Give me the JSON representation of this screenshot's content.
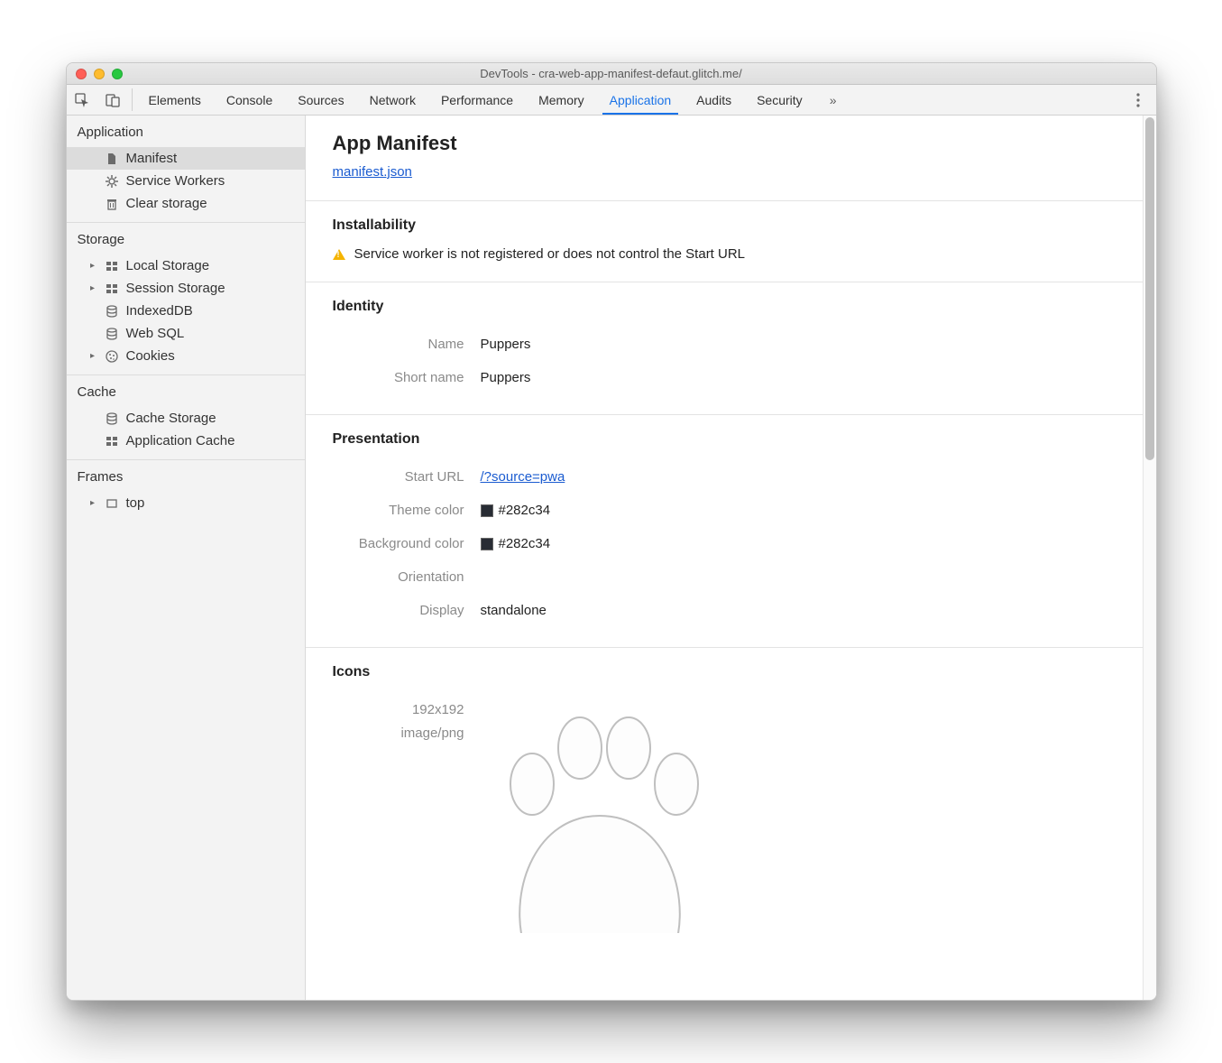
{
  "window": {
    "title": "DevTools - cra-web-app-manifest-defaut.glitch.me/"
  },
  "tabs": {
    "items": [
      "Elements",
      "Console",
      "Sources",
      "Network",
      "Performance",
      "Memory",
      "Application",
      "Audits",
      "Security"
    ],
    "active": "Application",
    "overflow_glyph": "»"
  },
  "sidebar": {
    "groups": [
      {
        "title": "Application",
        "items": [
          {
            "label": "Manifest",
            "icon": "file-icon",
            "selected": true,
            "expandable": false
          },
          {
            "label": "Service Workers",
            "icon": "gear-icon",
            "selected": false,
            "expandable": false
          },
          {
            "label": "Clear storage",
            "icon": "trash-icon",
            "selected": false,
            "expandable": false
          }
        ]
      },
      {
        "title": "Storage",
        "items": [
          {
            "label": "Local Storage",
            "icon": "grid-icon",
            "expandable": true
          },
          {
            "label": "Session Storage",
            "icon": "grid-icon",
            "expandable": true
          },
          {
            "label": "IndexedDB",
            "icon": "db-icon",
            "expandable": false
          },
          {
            "label": "Web SQL",
            "icon": "db-icon",
            "expandable": false
          },
          {
            "label": "Cookies",
            "icon": "cookie-icon",
            "expandable": true
          }
        ]
      },
      {
        "title": "Cache",
        "items": [
          {
            "label": "Cache Storage",
            "icon": "db-icon",
            "expandable": false
          },
          {
            "label": "Application Cache",
            "icon": "grid-icon",
            "expandable": false
          }
        ]
      },
      {
        "title": "Frames",
        "items": [
          {
            "label": "top",
            "icon": "frame-icon",
            "expandable": true
          }
        ]
      }
    ]
  },
  "main": {
    "title": "App Manifest",
    "manifest_link": "manifest.json",
    "installability": {
      "title": "Installability",
      "message": "Service worker is not registered or does not control the Start URL"
    },
    "identity": {
      "title": "Identity",
      "name_label": "Name",
      "name_value": "Puppers",
      "shortname_label": "Short name",
      "shortname_value": "Puppers"
    },
    "presentation": {
      "title": "Presentation",
      "starturl_label": "Start URL",
      "starturl_value": "/?source=pwa",
      "themecolor_label": "Theme color",
      "themecolor_value": "#282c34",
      "bgcolor_label": "Background color",
      "bgcolor_value": "#282c34",
      "orientation_label": "Orientation",
      "orientation_value": "",
      "display_label": "Display",
      "display_value": "standalone"
    },
    "icons": {
      "title": "Icons",
      "size": "192x192",
      "mime": "image/png"
    }
  },
  "colors": {
    "theme_swatch": "#282c34",
    "bg_swatch": "#282c34"
  }
}
